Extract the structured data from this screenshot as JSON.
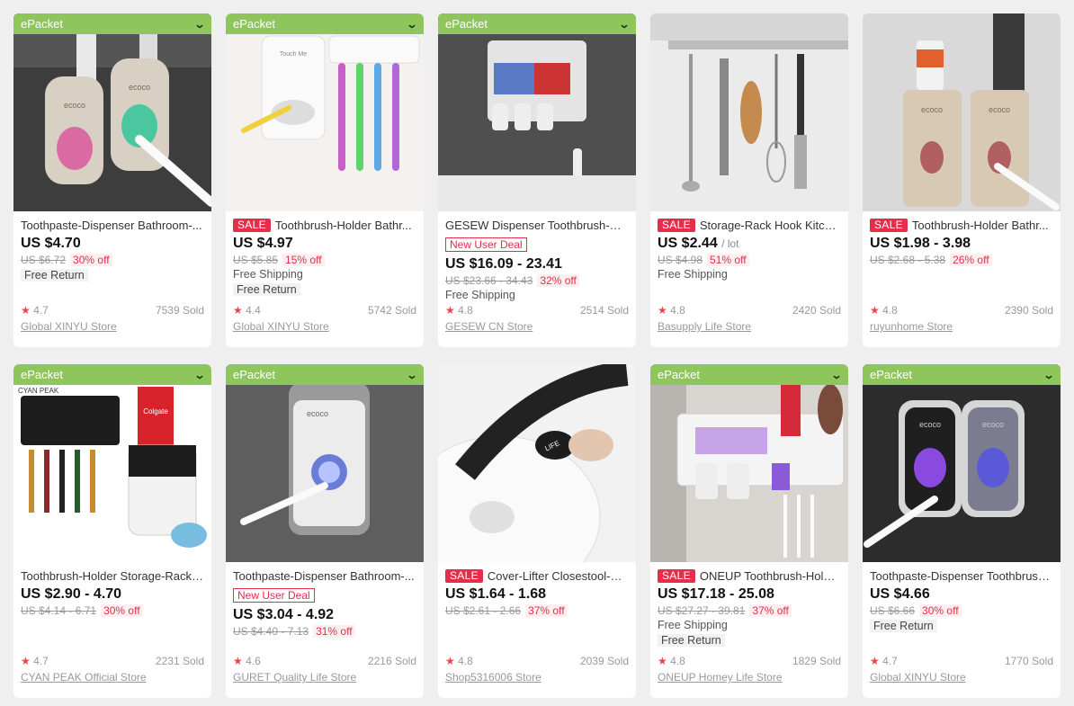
{
  "products": [
    {
      "badge": "ePacket",
      "sale": false,
      "title": "Toothpaste-Dispenser Bathroom-...",
      "new_user_deal": null,
      "price": "US $4.70",
      "unit": null,
      "orig": "US $6.72",
      "off": "30% off",
      "shipping": null,
      "free_return": "Free Return",
      "rating": "4.7",
      "sold": "7539 Sold",
      "store": "Global XINYU Store"
    },
    {
      "badge": "ePacket",
      "sale": true,
      "title": "Toothbrush-Holder Bathr...",
      "new_user_deal": null,
      "price": "US $4.97",
      "unit": null,
      "orig": "US $5.85",
      "off": "15% off",
      "shipping": "Free Shipping",
      "free_return": "Free Return",
      "rating": "4.4",
      "sold": "5742 Sold",
      "store": "Global XINYU Store"
    },
    {
      "badge": "ePacket",
      "sale": false,
      "title": "GESEW Dispenser Toothbrush-Hol...",
      "new_user_deal": "New User Deal",
      "price": "US $16.09 - 23.41",
      "unit": null,
      "orig": "US $23.66 - 34.43",
      "off": "32% off",
      "shipping": "Free Shipping",
      "free_return": null,
      "rating": "4.8",
      "sold": "2514 Sold",
      "store": "GESEW CN Store"
    },
    {
      "badge": null,
      "sale": true,
      "title": "Storage-Rack Hook Kitche...",
      "new_user_deal": null,
      "price": "US $2.44",
      "unit": "/ lot",
      "orig": "US $4.98",
      "off": "51% off",
      "shipping": "Free Shipping",
      "free_return": null,
      "rating": "4.8",
      "sold": "2420 Sold",
      "store": "Basupply Life Store"
    },
    {
      "badge": null,
      "sale": true,
      "title": "Toothbrush-Holder Bathr...",
      "new_user_deal": null,
      "price": "US $1.98 - 3.98",
      "unit": null,
      "orig": "US $2.68 - 5.38",
      "off": "26% off",
      "shipping": null,
      "free_return": null,
      "rating": "4.8",
      "sold": "2390 Sold",
      "store": "ruyunhome Store"
    },
    {
      "badge": "ePacket",
      "sale": false,
      "title": "Toothbrush-Holder Storage-Rack B...",
      "new_user_deal": null,
      "price": "US $2.90 - 4.70",
      "unit": null,
      "orig": "US $4.14 - 6.71",
      "off": "30% off",
      "shipping": null,
      "free_return": null,
      "rating": "4.7",
      "sold": "2231 Sold",
      "store": "CYAN PEAK Official Store"
    },
    {
      "badge": "ePacket",
      "sale": false,
      "title": "Toothpaste-Dispenser Bathroom-...",
      "new_user_deal": "New User Deal",
      "price": "US $3.04 - 4.92",
      "unit": null,
      "orig": "US $4.40 - 7.13",
      "off": "31% off",
      "shipping": null,
      "free_return": null,
      "rating": "4.6",
      "sold": "2216 Sold",
      "store": "GURET Quality Life Store"
    },
    {
      "badge": null,
      "sale": true,
      "title": "Cover-Lifter Closestool-Co...",
      "new_user_deal": null,
      "price": "US $1.64 - 1.68",
      "unit": null,
      "orig": "US $2.61 - 2.66",
      "off": "37% off",
      "shipping": null,
      "free_return": null,
      "rating": "4.8",
      "sold": "2039 Sold",
      "store": "Shop5316006 Store"
    },
    {
      "badge": "ePacket",
      "sale": true,
      "title": "ONEUP Toothbrush-Holde...",
      "new_user_deal": null,
      "price": "US $17.18 - 25.08",
      "unit": null,
      "orig": "US $27.27 - 39.81",
      "off": "37% off",
      "shipping": "Free Shipping",
      "free_return": "Free Return",
      "rating": "4.8",
      "sold": "1829 Sold",
      "store": "ONEUP Homey Life Store"
    },
    {
      "badge": "ePacket",
      "sale": false,
      "title": "Toothpaste-Dispenser Toothbrush...",
      "new_user_deal": null,
      "price": "US $4.66",
      "unit": null,
      "orig": "US $6.66",
      "off": "30% off",
      "shipping": null,
      "free_return": "Free Return",
      "rating": "4.7",
      "sold": "1770 Sold",
      "store": "Global XINYU Store"
    }
  ],
  "labels": {
    "sale": "SALE",
    "star": "★",
    "chevron": "⌄"
  },
  "image_text": {
    "p0": "ecoco",
    "p1": "Touch Me",
    "p4": "ecoco",
    "p5": "CYAN PEAK",
    "p5b": "Colgate",
    "p6": "ecoco",
    "p7": "LIFE",
    "p9a": "ecoco",
    "p9b": "ecoco"
  },
  "colors": {
    "badge": "#8fc65b",
    "sale": "#e62e4a",
    "star": "#e24a4a"
  }
}
